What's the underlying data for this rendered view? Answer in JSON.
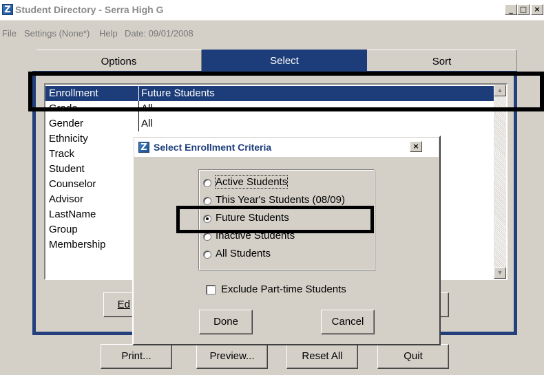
{
  "window": {
    "title": "Student Directory",
    "title_suffix": " - Serra High G",
    "logo_letter": "Z",
    "controls": [
      "_",
      "□",
      "×"
    ]
  },
  "menu": {
    "file": "File",
    "settings": "Settings (None*)",
    "help": "Help",
    "date": "Date: 09/01/2008"
  },
  "tabs": [
    "Options",
    "Select",
    "Sort"
  ],
  "criteria": [
    {
      "key": "Enrollment",
      "value": "Future Students"
    },
    {
      "key": "Grade",
      "value": "All"
    },
    {
      "key": "Gender",
      "value": "All"
    },
    {
      "key": "Ethnicity",
      "value": ""
    },
    {
      "key": "Track",
      "value": ""
    },
    {
      "key": "Student",
      "value": ""
    },
    {
      "key": "Counselor",
      "value": ""
    },
    {
      "key": "Advisor",
      "value": ""
    },
    {
      "key": "LastName",
      "value": ""
    },
    {
      "key": "Group",
      "value": ""
    },
    {
      "key": "Membership",
      "value": ""
    }
  ],
  "panel_buttons": {
    "edit": "Ed"
  },
  "bottom_buttons": {
    "print": "Print...",
    "preview": "Preview...",
    "reset": "Reset All",
    "quit": "Quit"
  },
  "dialog": {
    "title": "Select Enrollment Criteria",
    "options": [
      "Active Students",
      "This Year's Students (08/09)",
      "Future Students",
      "Inactive Students",
      "All Students"
    ],
    "selected_index": 2,
    "exclude_label": "Exclude Part-time Students",
    "exclude_checked": false,
    "done": "Done",
    "cancel": "Cancel"
  },
  "colors": {
    "accent": "#1c3d7a",
    "face": "#d4d0c8"
  }
}
